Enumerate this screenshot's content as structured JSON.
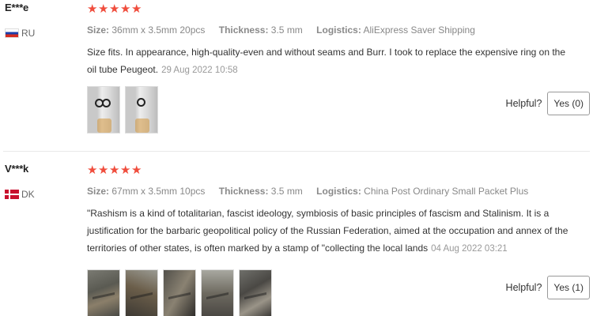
{
  "labels": {
    "size": "Size:",
    "thickness": "Thickness:",
    "logistics": "Logistics:",
    "helpful": "Helpful?"
  },
  "reviews": [
    {
      "user": "E***e",
      "country": "RU",
      "rating": 5,
      "size": "36mm x 3.5mm 20pcs",
      "thickness": "3.5 mm",
      "logistics": "AliExpress Saver Shipping",
      "text": "Size fits. In appearance, high-quality-even and without seams and Burr. I took to replace the expensive ring on the oil tube Peugeot.",
      "date": "29 Aug 2022 10:58",
      "photo_count": 2,
      "helpful_button": "Yes (0)"
    },
    {
      "user": "V***k",
      "country": "DK",
      "rating": 5,
      "size": "67mm x 3.5mm 10pcs",
      "thickness": "3.5 mm",
      "logistics": "China Post Ordinary Small Packet Plus",
      "text": "\"Rashism is a kind of totalitarian, fascist ideology, symbiosis of basic principles of fascism and Stalinism. It is a justification for the barbaric geopolitical policy of the Russian Federation, aimed at the occupation and annex of the territories of other states, is often marked by a stamp of \"collecting the local lands",
      "date": "04 Aug 2022 03:21",
      "photo_count": 5,
      "helpful_button": "Yes (1)"
    }
  ],
  "colors": {
    "star": "#f04d3d",
    "meta_text": "#888888",
    "divider": "#e8e8e8"
  },
  "icons": {
    "star": "star-icon",
    "flag_ru": "russia-flag-icon",
    "flag_dk": "denmark-flag-icon"
  }
}
